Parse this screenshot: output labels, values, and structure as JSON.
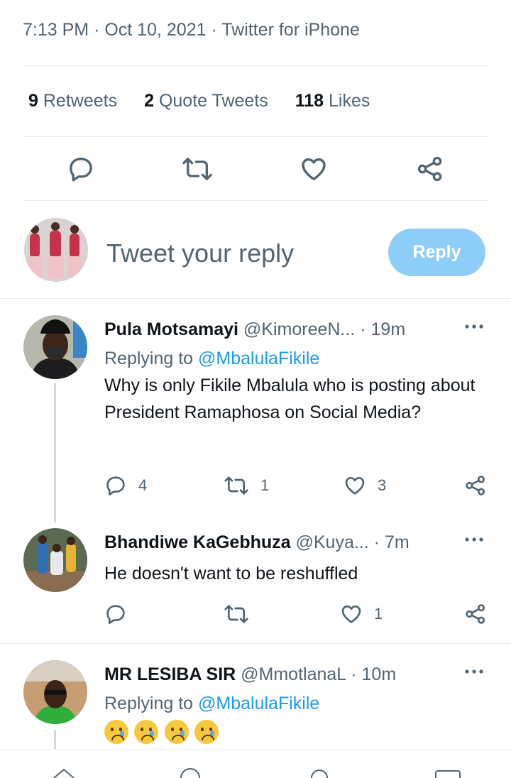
{
  "tweet_meta": {
    "time": "7:13 PM",
    "sep1": "·",
    "date": "Oct 10, 2021",
    "sep2": "·",
    "source": "Twitter for iPhone"
  },
  "stats": {
    "retweets_count": "9",
    "retweets_label": "Retweets",
    "quotes_count": "2",
    "quotes_label": "Quote Tweets",
    "likes_count": "118",
    "likes_label": "Likes"
  },
  "action_icons": [
    "reply-icon",
    "retweet-icon",
    "like-icon",
    "share-icon"
  ],
  "composer": {
    "placeholder": "Tweet your reply",
    "button_label": "Reply"
  },
  "colors": {
    "accent": "#1d9bf0",
    "reply_button_disabled": "#8ecdf7",
    "muted_text": "#536471"
  },
  "replies": [
    {
      "name": "Pula Motsamayi",
      "handle": "@KimoreeN...",
      "sep": "·",
      "time": "19m",
      "replying_prefix": "Replying to",
      "replying_to": "@MbalulaFikile",
      "text": "Why is only Fikile Mbalula who is posting about President Ramaphosa on Social Media?",
      "reply_count": "4",
      "retweet_count": "1",
      "like_count": "3"
    },
    {
      "name": "Bhandiwe KaGebhuza",
      "handle": "@Kuya...",
      "sep": "·",
      "time": "7m",
      "text": "He doesn't want to be reshuffled",
      "reply_count": "",
      "retweet_count": "",
      "like_count": "1"
    },
    {
      "name": "MR LESIBA SIR",
      "handle": "@MmotlanaL",
      "sep": "·",
      "time": "10m",
      "replying_prefix": "Replying to",
      "replying_to": "@MbalulaFikile",
      "emoji_count": 4
    }
  ]
}
